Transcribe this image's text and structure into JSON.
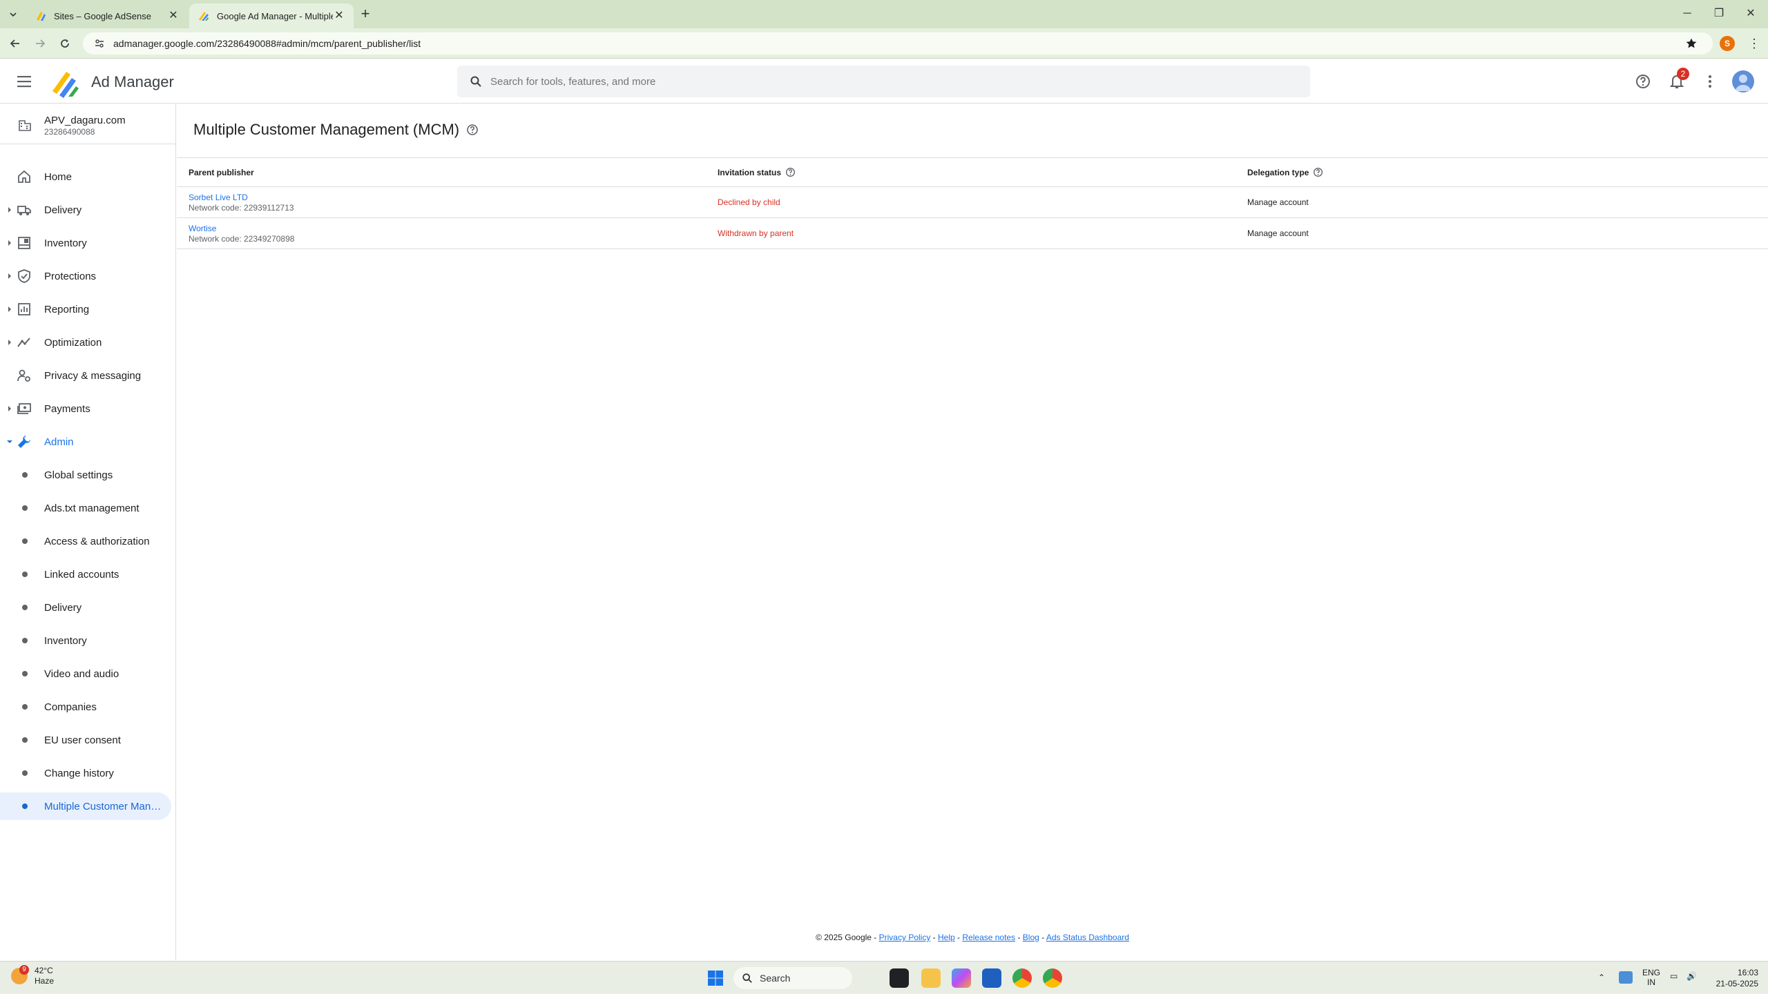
{
  "browser": {
    "tabs": [
      {
        "title": "Sites – Google AdSense",
        "active": false
      },
      {
        "title": "Google Ad Manager - Multiple",
        "active": true
      }
    ],
    "url": "admanager.google.com/23286490088#admin/mcm/parent_publisher/list",
    "profile_initial": "S"
  },
  "app": {
    "product_name": "Ad Manager",
    "search_placeholder": "Search for tools, features, and more",
    "notification_count": "2"
  },
  "network": {
    "name": "APV_dagaru.com",
    "code": "23286490088"
  },
  "nav": {
    "items": [
      {
        "label": "Home",
        "icon": "home-icon"
      },
      {
        "label": "Delivery",
        "icon": "delivery-truck-icon"
      },
      {
        "label": "Inventory",
        "icon": "inventory-icon"
      },
      {
        "label": "Protections",
        "icon": "shield-check-icon"
      },
      {
        "label": "Reporting",
        "icon": "bar-chart-icon"
      },
      {
        "label": "Optimization",
        "icon": "trend-line-icon"
      },
      {
        "label": "Privacy & messaging",
        "icon": "person-gear-icon"
      },
      {
        "label": "Payments",
        "icon": "payments-icon"
      },
      {
        "label": "Admin",
        "icon": "wrench-icon"
      }
    ],
    "admin_subitems": [
      {
        "label": "Global settings"
      },
      {
        "label": "Ads.txt management"
      },
      {
        "label": "Access & authorization"
      },
      {
        "label": "Linked accounts"
      },
      {
        "label": "Delivery"
      },
      {
        "label": "Inventory"
      },
      {
        "label": "Video and audio"
      },
      {
        "label": "Companies"
      },
      {
        "label": "EU user consent"
      },
      {
        "label": "Change history"
      },
      {
        "label": "Multiple Customer Manag..."
      }
    ]
  },
  "page": {
    "title": "Multiple Customer Management (MCM)",
    "columns": {
      "parent_publisher": "Parent publisher",
      "invitation_status": "Invitation status",
      "delegation_type": "Delegation type"
    },
    "rows": [
      {
        "publisher": "Sorbet Live LTD",
        "network_code": "Network code: 22939112713",
        "status": "Declined by child",
        "delegation": "Manage account"
      },
      {
        "publisher": "Wortise",
        "network_code": "Network code: 22349270898",
        "status": "Withdrawn by parent",
        "delegation": "Manage account"
      }
    ]
  },
  "footer": {
    "copyright": "© 2025 Google -",
    "links": [
      "Privacy Policy",
      "Help",
      "Release notes",
      "Blog",
      "Ads Status Dashboard"
    ],
    "sep": "-"
  },
  "taskbar": {
    "weather_badge": "9",
    "temperature": "42°C",
    "condition": "Haze",
    "search_label": "Search",
    "lang_line1": "ENG",
    "lang_line2": "IN",
    "time": "16:03",
    "date": "21-05-2025"
  },
  "colors": {
    "accent": "#1a73e8",
    "error": "#d93025",
    "chrome_frame": "#d3e3c8"
  }
}
